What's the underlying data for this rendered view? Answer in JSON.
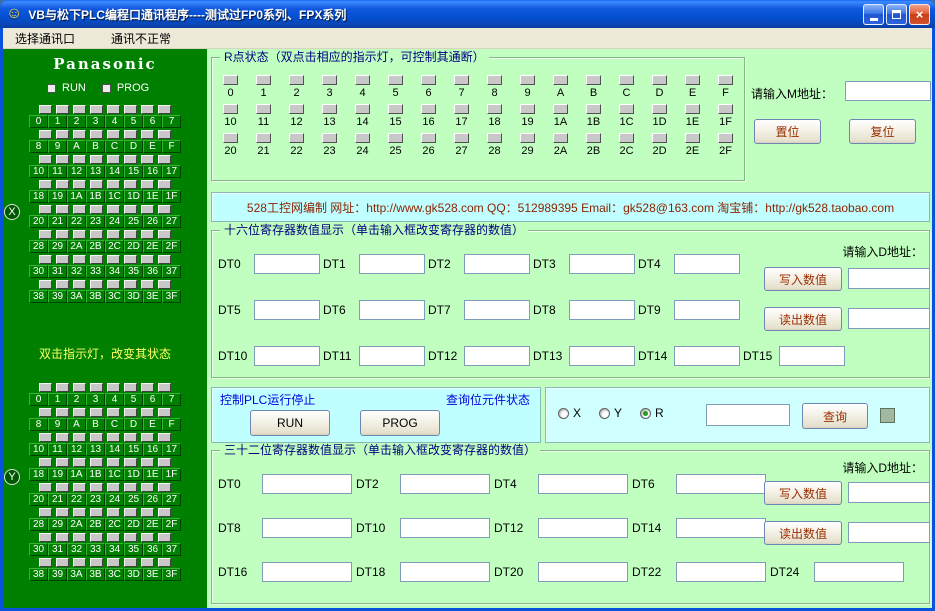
{
  "window": {
    "title": "VB与松下PLC编程口通讯程序----测试过FP0系列、FPX系列"
  },
  "menu": {
    "items": [
      "选择通讯口",
      "通讯不正常"
    ]
  },
  "left_panel": {
    "brand": "Panasonic",
    "run_label": "RUN",
    "prog_label": "PROG",
    "note": "双击指示灯，改变其状态",
    "x_badge": "X",
    "y_badge": "Y",
    "grid_labels": [
      "0",
      "1",
      "2",
      "3",
      "4",
      "5",
      "6",
      "7",
      "8",
      "9",
      "A",
      "B",
      "C",
      "D",
      "E",
      "F",
      "10",
      "11",
      "12",
      "13",
      "14",
      "15",
      "16",
      "17",
      "18",
      "19",
      "1A",
      "1B",
      "1C",
      "1D",
      "1E",
      "1F",
      "20",
      "21",
      "22",
      "23",
      "24",
      "25",
      "26",
      "27",
      "28",
      "29",
      "2A",
      "2B",
      "2C",
      "2D",
      "2E",
      "2F",
      "30",
      "31",
      "32",
      "33",
      "34",
      "35",
      "36",
      "37",
      "38",
      "39",
      "3A",
      "3B",
      "3C",
      "3D",
      "3E",
      "3F"
    ]
  },
  "r_status": {
    "title": "R点状态（双点击相应的指示灯，可控制其通断）",
    "rows": [
      [
        "0",
        "1",
        "2",
        "3",
        "4",
        "5",
        "6",
        "7",
        "8",
        "9",
        "A",
        "B",
        "C",
        "D",
        "E",
        "F"
      ],
      [
        "10",
        "11",
        "12",
        "13",
        "14",
        "15",
        "16",
        "17",
        "18",
        "19",
        "1A",
        "1B",
        "1C",
        "1D",
        "1E",
        "1F"
      ],
      [
        "20",
        "21",
        "22",
        "23",
        "24",
        "25",
        "26",
        "27",
        "28",
        "29",
        "2A",
        "2B",
        "2C",
        "2D",
        "2E",
        "2F"
      ]
    ]
  },
  "m_address": {
    "label": "请输入M地址：",
    "value": "",
    "set_button": "置位",
    "reset_button": "复位"
  },
  "info_bar": {
    "text": "528工控网编制 网址：http://www.gk528.com QQ：512989395 Email：gk528@163.com 淘宝铺：http://gk528.taobao.com"
  },
  "reg16": {
    "title": "十六位寄存器数值显示（单击输入框改变寄存器的数值）",
    "rows": [
      [
        "DT0",
        "DT1",
        "DT2",
        "DT3",
        "DT4"
      ],
      [
        "DT5",
        "DT6",
        "DT7",
        "DT8",
        "DT9"
      ],
      [
        "DT10",
        "DT11",
        "DT12",
        "DT13",
        "DT14",
        "DT15"
      ]
    ],
    "values": "",
    "d_address_label": "请输入D地址：",
    "d_address_value": "",
    "write_button": "写入数值",
    "read_button": "读出数值"
  },
  "plc_control": {
    "title": "控制PLC运行停止",
    "run_button": "RUN",
    "prog_button": "PROG"
  },
  "bit_query": {
    "title": "查询位元件状态",
    "options": [
      {
        "label": "X",
        "selected": false
      },
      {
        "label": "Y",
        "selected": false
      },
      {
        "label": "R",
        "selected": true
      }
    ],
    "address_value": "",
    "query_button": "查询"
  },
  "reg32": {
    "title": "三十二位寄存器数值显示（单击输入框改变寄存器的数值）",
    "rows": [
      [
        "DT0",
        "DT2",
        "DT4",
        "DT6"
      ],
      [
        "DT8",
        "DT10",
        "DT12",
        "DT14"
      ],
      [
        "DT16",
        "DT18",
        "DT20",
        "DT22",
        "DT24"
      ]
    ],
    "values": "",
    "d_address_label": "请输入D地址：",
    "d_address_value": "",
    "write_button": "写入数值",
    "read_button": "读出数值"
  },
  "colors": {
    "left_panel_bg": "#008000",
    "main_bg": "#C0FFC0",
    "cyan_bg": "#C0FFFF",
    "group_title": "#000080",
    "section_title": "#0000E0",
    "info_text": "#8B2500",
    "button_text_cn": "#9B2D00"
  }
}
